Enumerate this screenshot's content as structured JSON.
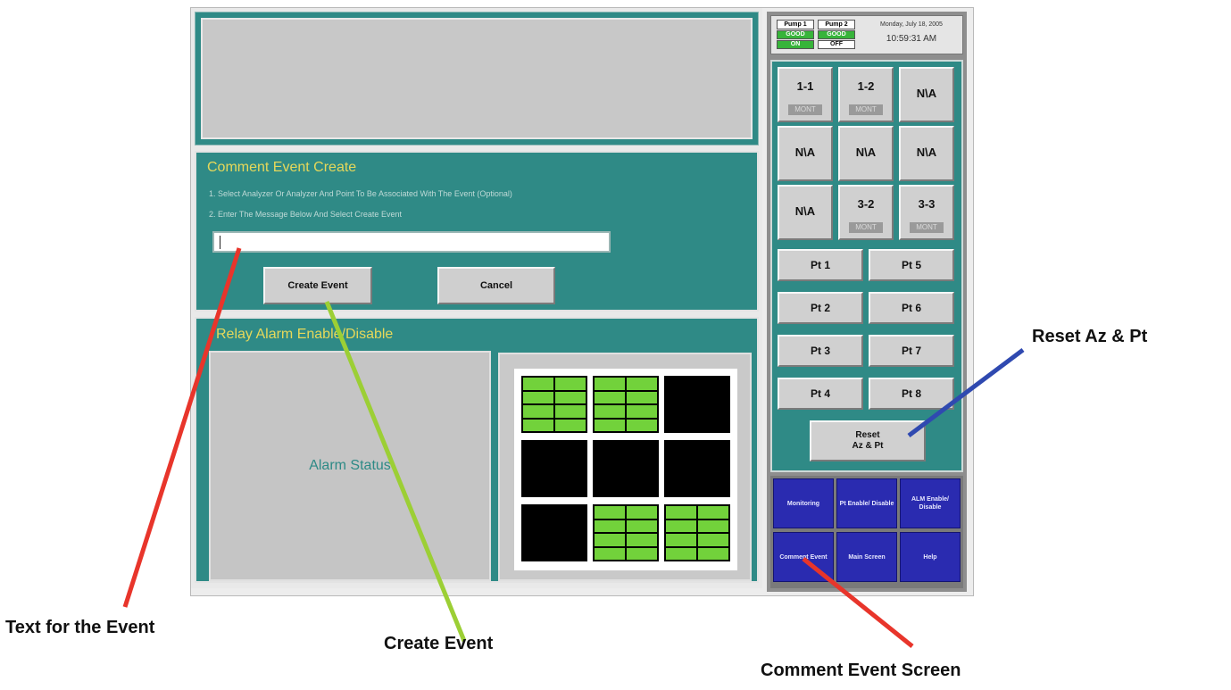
{
  "comment_panel": {
    "title": "Comment Event Create",
    "instruction_1": "1. Select Analyzer Or Analyzer And Point To Be Associated With The Event (Optional)",
    "instruction_2": "2. Enter The Message Below And Select Create Event",
    "event_text_value": "",
    "create_button_label": "Create Event",
    "cancel_button_label": "Cancel"
  },
  "relay_panel": {
    "title": "Relay Alarm Enable/Disable",
    "alarm_status_label": "Alarm Status",
    "grid_cells": [
      {
        "state": "on"
      },
      {
        "state": "on"
      },
      {
        "state": "off"
      },
      {
        "state": "off"
      },
      {
        "state": "off"
      },
      {
        "state": "off"
      },
      {
        "state": "off"
      },
      {
        "state": "on"
      },
      {
        "state": "on"
      }
    ]
  },
  "status": {
    "pump1_name": "Pump 1",
    "pump1_state": "GOOD",
    "pump1_power": "ON",
    "pump2_name": "Pump 2",
    "pump2_state": "GOOD",
    "pump2_power": "OFF",
    "date": "Monday, July 18, 2005",
    "time": "10:59:31 AM",
    "good_color": "#37b43a"
  },
  "analyzers": [
    {
      "label": "1-1",
      "tag": "MONT"
    },
    {
      "label": "1-2",
      "tag": "MONT"
    },
    {
      "label": "N\\A",
      "tag": ""
    },
    {
      "label": "N\\A",
      "tag": ""
    },
    {
      "label": "N\\A",
      "tag": ""
    },
    {
      "label": "N\\A",
      "tag": ""
    },
    {
      "label": "N\\A",
      "tag": ""
    },
    {
      "label": "3-2",
      "tag": "MONT"
    },
    {
      "label": "3-3",
      "tag": "MONT"
    }
  ],
  "points": [
    "Pt 1",
    "Pt 5",
    "Pt 2",
    "Pt 6",
    "Pt 3",
    "Pt 7",
    "Pt 4",
    "Pt 8"
  ],
  "reset_button": {
    "line1": "Reset",
    "line2": "Az & Pt"
  },
  "nav": [
    {
      "label": "Monitoring"
    },
    {
      "label": "Pt Enable/ Disable"
    },
    {
      "label": "ALM Enable/ Disable"
    },
    {
      "label": "Comment Event"
    },
    {
      "label": "Main Screen"
    },
    {
      "label": "Help"
    }
  ],
  "callouts": {
    "text_for_event": "Text for the Event",
    "create_event": "Create Event",
    "reset_az_pt": "Reset Az & Pt",
    "comment_event_screen": "Comment Event Screen"
  },
  "colors": {
    "panel_teal": "#2f8a86",
    "title_yellow": "#e6d85a",
    "nav_blue": "#2a2bb0",
    "relay_green": "#72d23b",
    "callout_red": "#e8352b",
    "callout_green": "#9ccf35",
    "callout_blue": "#2f49b0"
  }
}
